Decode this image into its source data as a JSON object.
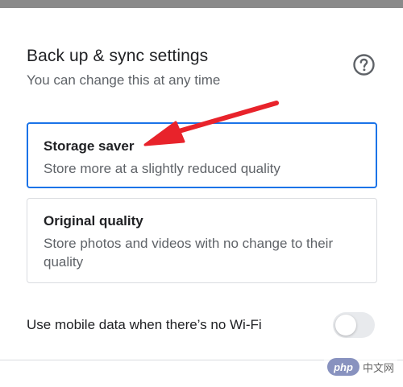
{
  "header": {
    "title": "Back up & sync settings",
    "subtitle": "You can change this at any time"
  },
  "options": [
    {
      "title": "Storage saver",
      "description": "Store more at a slightly reduced quality",
      "selected": true
    },
    {
      "title": "Original quality",
      "description": "Store photos and videos with no change to their quality",
      "selected": false
    }
  ],
  "mobile_data": {
    "label": "Use mobile data when there’s no Wi‑Fi",
    "enabled": false
  },
  "watermark": {
    "logo_text": "php",
    "site_text": "中文网"
  },
  "colors": {
    "accent": "#1a73e8",
    "arrow": "#e8232b",
    "top_bar": "#8a8a8a"
  },
  "icons": {
    "help": "help-circle-icon",
    "annotation": "red-arrow-icon"
  }
}
